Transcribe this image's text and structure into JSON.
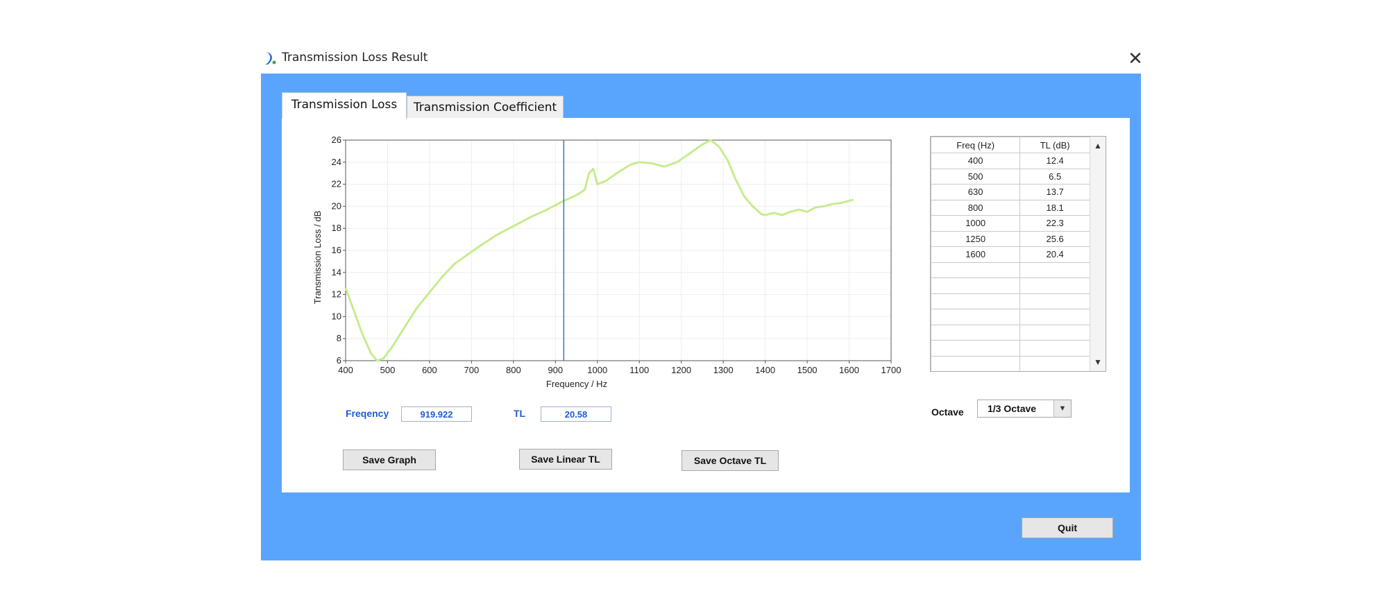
{
  "window": {
    "title": "Transmission Loss Result",
    "close_glyph": "✕"
  },
  "tabs": [
    {
      "label": "Transmission Loss",
      "active": true
    },
    {
      "label": "Transmission Coefficient",
      "active": false
    }
  ],
  "chart_data": {
    "type": "line",
    "xlabel": "Frequency / Hz",
    "ylabel": "Transmission Loss  / dB",
    "xlim": [
      400,
      1700
    ],
    "ylim": [
      6,
      26
    ],
    "xticks": [
      400,
      500,
      600,
      700,
      800,
      900,
      1000,
      1100,
      1200,
      1300,
      1400,
      1500,
      1600,
      1700
    ],
    "yticks": [
      6,
      8,
      10,
      12,
      14,
      16,
      18,
      20,
      22,
      24,
      26
    ],
    "grid": true,
    "line_color": "#c6ec8c",
    "cursor_color": "#3b6fd6",
    "cursor_x": 919.922,
    "series": [
      {
        "x": [
          400,
          420,
          440,
          460,
          475,
          490,
          510,
          540,
          570,
          600,
          630,
          660,
          690,
          720,
          760,
          800,
          840,
          880,
          920,
          950,
          970,
          980,
          990,
          1000,
          1020,
          1050,
          1080,
          1100,
          1130,
          1160,
          1190,
          1220,
          1250,
          1270,
          1290,
          1310,
          1330,
          1350,
          1370,
          1390,
          1400,
          1420,
          1440,
          1460,
          1480,
          1500,
          1520,
          1540,
          1560,
          1580,
          1600,
          1610
        ],
        "y": [
          12.6,
          10.5,
          8.4,
          6.7,
          6.0,
          6.2,
          7.2,
          9.0,
          10.8,
          12.2,
          13.6,
          14.8,
          15.6,
          16.4,
          17.4,
          18.2,
          19.0,
          19.7,
          20.5,
          21.0,
          21.5,
          23.0,
          23.4,
          22.0,
          22.3,
          23.1,
          23.8,
          24.0,
          23.9,
          23.6,
          24.0,
          24.8,
          25.6,
          26.0,
          25.4,
          24.2,
          22.4,
          20.9,
          20.0,
          19.3,
          19.2,
          19.4,
          19.2,
          19.5,
          19.7,
          19.5,
          19.9,
          20.0,
          20.2,
          20.3,
          20.5,
          20.6
        ]
      }
    ]
  },
  "readout": {
    "freq_label": "Freqency",
    "freq_value": "919.922",
    "tl_label": "TL",
    "tl_value": "20.58"
  },
  "buttons": {
    "save_graph": "Save Graph",
    "save_linear": "Save Linear TL",
    "save_octave": "Save Octave TL",
    "quit": "Quit"
  },
  "table": {
    "headers": [
      "Freq (Hz)",
      "TL (dB)"
    ],
    "rows": [
      [
        "400",
        "12.4"
      ],
      [
        "500",
        "6.5"
      ],
      [
        "630",
        "13.7"
      ],
      [
        "800",
        "18.1"
      ],
      [
        "1000",
        "22.3"
      ],
      [
        "1250",
        "25.6"
      ],
      [
        "1600",
        "20.4"
      ]
    ],
    "empty_rows": 7
  },
  "octave": {
    "label": "Octave",
    "value": "1/3 Octave"
  },
  "colors": {
    "window_bg": "#59a5fd",
    "panel_bg": "#ffffff",
    "accent_text": "#1f5bd6"
  }
}
